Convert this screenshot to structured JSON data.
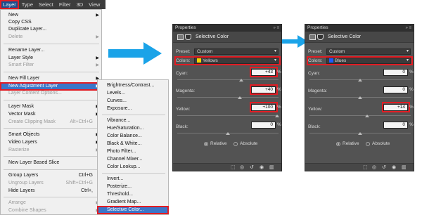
{
  "menubar": {
    "items": [
      "Layer",
      "Type",
      "Select",
      "Filter",
      "3D",
      "View"
    ]
  },
  "menu": [
    {
      "label": "New",
      "arrow": true
    },
    {
      "label": "Copy CSS"
    },
    {
      "label": "Duplicate Layer..."
    },
    {
      "label": "Delete",
      "disabled": true,
      "arrow": true
    },
    {
      "label": "Rename Layer..."
    },
    {
      "label": "Layer Style",
      "arrow": true
    },
    {
      "label": "Smart Filter",
      "disabled": true,
      "arrow": true
    },
    {
      "label": "New Fill Layer",
      "arrow": true
    },
    {
      "label": "New Adjustment Layer",
      "arrow": true
    },
    {
      "label": "Layer Content Options...",
      "disabled": true
    },
    {
      "label": "Layer Mask",
      "arrow": true
    },
    {
      "label": "Vector Mask",
      "arrow": true
    },
    {
      "label": "Create Clipping Mask",
      "disabled": true,
      "shortcut": "Alt+Ctrl+G"
    },
    {
      "label": "Smart Objects",
      "arrow": true
    },
    {
      "label": "Video Layers",
      "arrow": true
    },
    {
      "label": "Rasterize",
      "disabled": true,
      "arrow": true
    },
    {
      "label": "New Layer Based Slice"
    },
    {
      "label": "Group Layers",
      "shortcut": "Ctrl+G"
    },
    {
      "label": "Ungroup Layers",
      "disabled": true,
      "shortcut": "Shift+Ctrl+G"
    },
    {
      "label": "Hide Layers",
      "shortcut": "Ctrl+,"
    },
    {
      "label": "Arrange",
      "disabled": true,
      "arrow": true
    },
    {
      "label": "Combine Shapes",
      "disabled": true,
      "arrow": true
    }
  ],
  "submenu": [
    "Brightness/Contrast...",
    "Levels...",
    "Curves...",
    "Exposure...",
    "Vibrance...",
    "Hue/Saturation...",
    "Color Balance...",
    "Black & White...",
    "Photo Filter...",
    "Channel Mixer...",
    "Color Lookup...",
    "Invert...",
    "Posterize...",
    "Threshold...",
    "Gradient Map...",
    "Selective Color..."
  ],
  "panels": [
    {
      "title": "Properties",
      "header": "Selective Color",
      "preset_label": "Preset:",
      "preset_value": "Custom",
      "colors_label": "Colors:",
      "colors_value": "Yellows",
      "swatch": "#f2d600",
      "rows": [
        {
          "label": "Cyan:",
          "value": "+43",
          "highlight": true
        },
        {
          "label": "Magenta:",
          "value": "+40",
          "highlight": true
        },
        {
          "label": "Yellow:",
          "value": "+100",
          "highlight": true
        },
        {
          "label": "Black:",
          "value": "0",
          "highlight": false
        }
      ],
      "relative": "Relative",
      "absolute": "Absolute"
    },
    {
      "title": "Properties",
      "header": "Selective Color",
      "preset_label": "Preset:",
      "preset_value": "Custom",
      "colors_label": "Colors:",
      "colors_value": "Blues",
      "swatch": "#1d5bff",
      "rows": [
        {
          "label": "Cyan:",
          "value": "0",
          "highlight": false
        },
        {
          "label": "Magenta:",
          "value": "0",
          "highlight": false
        },
        {
          "label": "Yellow:",
          "value": "+14",
          "highlight": true
        },
        {
          "label": "Black:",
          "value": "0",
          "highlight": false
        }
      ],
      "relative": "Relative",
      "absolute": "Absolute"
    }
  ],
  "percent": "%",
  "colors": {
    "arrow": "#1aa3e8",
    "highlight": "#e31c23",
    "selection": "#3a76c9"
  }
}
